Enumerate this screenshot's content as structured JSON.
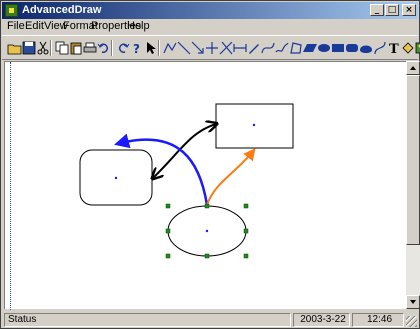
{
  "window": {
    "title": "AdvancedDraw",
    "minimize_glyph": "_",
    "maximize_glyph": "□",
    "close_glyph": "×"
  },
  "menu": [
    {
      "label": "File"
    },
    {
      "label": "Edit"
    },
    {
      "label": "View"
    },
    {
      "label": "Format"
    },
    {
      "label": "Properties"
    },
    {
      "label": "Help"
    }
  ],
  "toolbar": {
    "icons": [
      "open-icon",
      "save-icon",
      "cut-icon",
      "copy-icon",
      "paste-icon",
      "print-icon",
      "undo-icon",
      "redo-icon",
      "help-icon",
      "pointer-icon",
      "polyline-icon",
      "line-icon",
      "arrow-line-icon",
      "cross-icon",
      "connector-icon",
      "dimension-icon",
      "pen-icon",
      "curve-icon",
      "freehand-icon",
      "polygon-icon",
      "parallelogram-icon",
      "ellipse-icon",
      "rectangle-icon",
      "rounded-rect-icon",
      "filled-shape-icon",
      "bezier-icon",
      "text-icon",
      "fill-icon",
      "image-icon",
      "more-icon"
    ]
  },
  "colors": {
    "arrow_black": "#000000",
    "arrow_blue": "#1a1aff",
    "arrow_orange": "#ff7a10",
    "handle_green": "#1f8a1f",
    "center_dot": "#1a1aff"
  },
  "status": {
    "text": "Status",
    "date": "2003-3-22",
    "time": "12:46"
  }
}
